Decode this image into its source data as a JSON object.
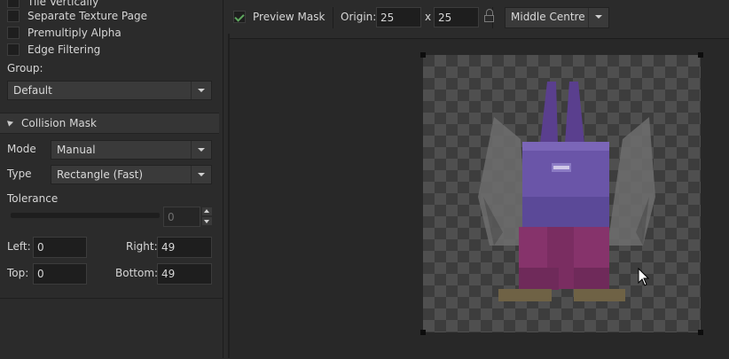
{
  "texture_options": {
    "items": [
      {
        "label": "Tile Vertically",
        "checked": false
      },
      {
        "label": "Separate Texture Page",
        "checked": false
      },
      {
        "label": "Premultiply Alpha",
        "checked": false
      },
      {
        "label": "Edge Filtering",
        "checked": false
      }
    ]
  },
  "group": {
    "label": "Group:",
    "value": "Default"
  },
  "collision_mask": {
    "title": "Collision Mask",
    "mode_label": "Mode",
    "mode_value": "Manual",
    "type_label": "Type",
    "type_value": "Rectangle (Fast)",
    "tolerance_label": "Tolerance",
    "tolerance_value": "0",
    "left_label": "Left:",
    "left_value": "0",
    "right_label": "Right:",
    "right_value": "49",
    "top_label": "Top:",
    "top_value": "0",
    "bottom_label": "Bottom:",
    "bottom_value": "49"
  },
  "toolbar": {
    "preview_mask_label": "Preview Mask",
    "preview_mask_checked": true,
    "origin_label": "Origin:",
    "origin_x": "25",
    "origin_sep": "x",
    "origin_y": "25",
    "origin_preset": "Middle Centre"
  },
  "icons": {
    "lock": "lock-icon",
    "cursor": "mouse-pointer-icon"
  },
  "colors": {
    "panel_bg": "#2b2b2b",
    "checker_dark": "#3d3d3d",
    "checker_light": "#4f4f4f",
    "checkmark": "#5fa85f"
  }
}
